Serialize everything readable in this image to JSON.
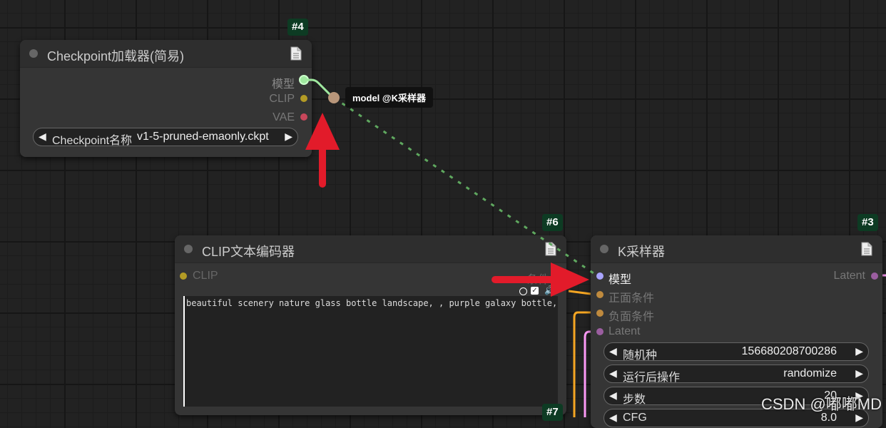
{
  "nodes": {
    "checkpoint": {
      "id": "#4",
      "title": "Checkpoint加载器(简易)",
      "outputs": [
        "模型",
        "CLIP",
        "VAE"
      ],
      "widget": {
        "label": "Checkpoint名称",
        "value": "v1-5-pruned-emaonly.ckpt"
      }
    },
    "clip_text": {
      "id": "#6",
      "id_below": "#7",
      "title": "CLIP文本编码器",
      "input": "CLIP",
      "output": "条件",
      "text": "beautiful scenery nature glass bottle landscape, , purple galaxy bottle,"
    },
    "ksampler": {
      "id": "#3",
      "title": "K采样器",
      "inputs": [
        "模型",
        "正面条件",
        "负面条件",
        "Latent"
      ],
      "output": "Latent",
      "widgets": [
        {
          "label": "随机种",
          "value": "156680208700286"
        },
        {
          "label": "运行后操作",
          "value": "randomize"
        },
        {
          "label": "步数",
          "value": "20"
        },
        {
          "label": "CFG",
          "value": "8.0"
        }
      ]
    }
  },
  "tooltip": "model @K采样器",
  "watermark": "CSDN @嘟嘟MD",
  "icons": {
    "node_status": "circle-icon",
    "properties": "document-icon",
    "annotation": "red-arrow-icon"
  },
  "colors": {
    "model_port": "#9fe89f",
    "clip_port": "#b39b25",
    "vae_port": "#c8475b",
    "conditioning_port": "#bf8a3e",
    "latent_port": "#ff9cf9",
    "link_model": "#5fa85f",
    "link_conditioning": "#f5a623",
    "link_latent": "#ff9cf9",
    "annotation_red": "#e21b2a",
    "badge_bg": "#0d3b23"
  }
}
